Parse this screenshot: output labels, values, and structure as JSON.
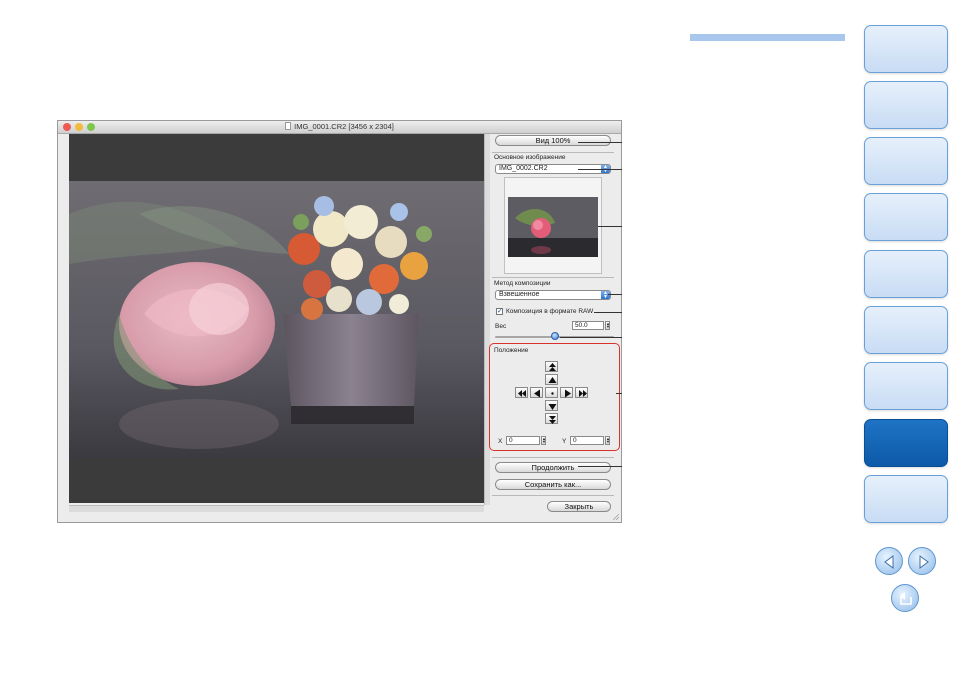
{
  "window": {
    "title": "IMG_0001.CR2 [3456 x 2304]",
    "traffic_lights": {
      "close": "#ec5b55",
      "minimize": "#f2bb3b",
      "zoom": "#7ec74b"
    }
  },
  "panel": {
    "view100_label": "Вид 100%",
    "base_image_label": "Основное изображение",
    "base_image_value": "IMG_0002.CR2",
    "method_label": "Метод композиции",
    "method_value": "Взвешенное",
    "raw_compose_label": "Композиция в формате RAW",
    "raw_compose_checked": true,
    "weight_label": "Вес",
    "weight_value": "50.0",
    "weight_slider_fraction": 0.5,
    "position_label": "Положение",
    "x_label": "X",
    "x_value": "0",
    "y_label": "Y",
    "y_value": "0",
    "continue_label": "Продолжить",
    "save_as_label": "Сохранить как...",
    "close_label": "Закрыть"
  },
  "theme": {
    "accent_blue": "#2f73d1",
    "highlight_red": "#d8332b",
    "active_tab": "#0c5aa8"
  },
  "manual_nav": {
    "tabs_count": 9,
    "active_tab_index": 7,
    "icons": [
      "prev-page-icon",
      "next-page-icon",
      "return-icon"
    ]
  }
}
